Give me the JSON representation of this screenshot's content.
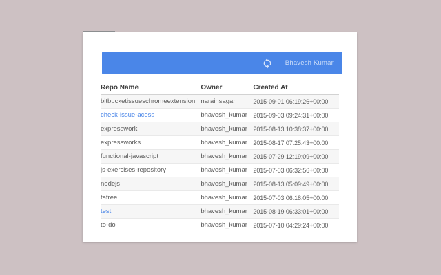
{
  "window": {
    "background_color": "#cdc1c3",
    "card_color": "#ffffff"
  },
  "toolbar": {
    "background_color": "#4a86e8",
    "refresh_icon": "refresh-icon",
    "user_name": "Bhavesh Kumar",
    "text_color": "rgba(255,255,255,0.70)"
  },
  "table": {
    "columns": [
      "Repo Name",
      "Owner",
      "Created At"
    ],
    "link_color": "#4a86e8",
    "stripe_color": "#f6f6f6",
    "rows": [
      {
        "repo": "bitbucketissueschromeextension",
        "owner": "narainsagar",
        "created_at": "2015-09-01 06:19:26+00:00",
        "link": false
      },
      {
        "repo": "check-issue-acess",
        "owner": "bhavesh_kumar",
        "created_at": "2015-09-03 09:24:31+00:00",
        "link": true
      },
      {
        "repo": "expresswork",
        "owner": "bhavesh_kumar",
        "created_at": "2015-08-13 10:38:37+00:00",
        "link": false
      },
      {
        "repo": "expressworks",
        "owner": "bhavesh_kumar",
        "created_at": "2015-08-17 07:25:43+00:00",
        "link": false
      },
      {
        "repo": "functional-javascript",
        "owner": "bhavesh_kumar",
        "created_at": "2015-07-29 12:19:09+00:00",
        "link": false
      },
      {
        "repo": "js-exercises-repository",
        "owner": "bhavesh_kumar",
        "created_at": "2015-07-03 06:32:56+00:00",
        "link": false
      },
      {
        "repo": "nodejs",
        "owner": "bhavesh_kumar",
        "created_at": "2015-08-13 05:09:49+00:00",
        "link": false
      },
      {
        "repo": "tafree",
        "owner": "bhavesh_kumar",
        "created_at": "2015-07-03 06:18:05+00:00",
        "link": false
      },
      {
        "repo": "test",
        "owner": "bhavesh_kumar",
        "created_at": "2015-08-19 06:33:01+00:00",
        "link": true
      },
      {
        "repo": "to-do",
        "owner": "bhavesh_kumar",
        "created_at": "2015-07-10 04:29:24+00:00",
        "link": false
      }
    ]
  }
}
